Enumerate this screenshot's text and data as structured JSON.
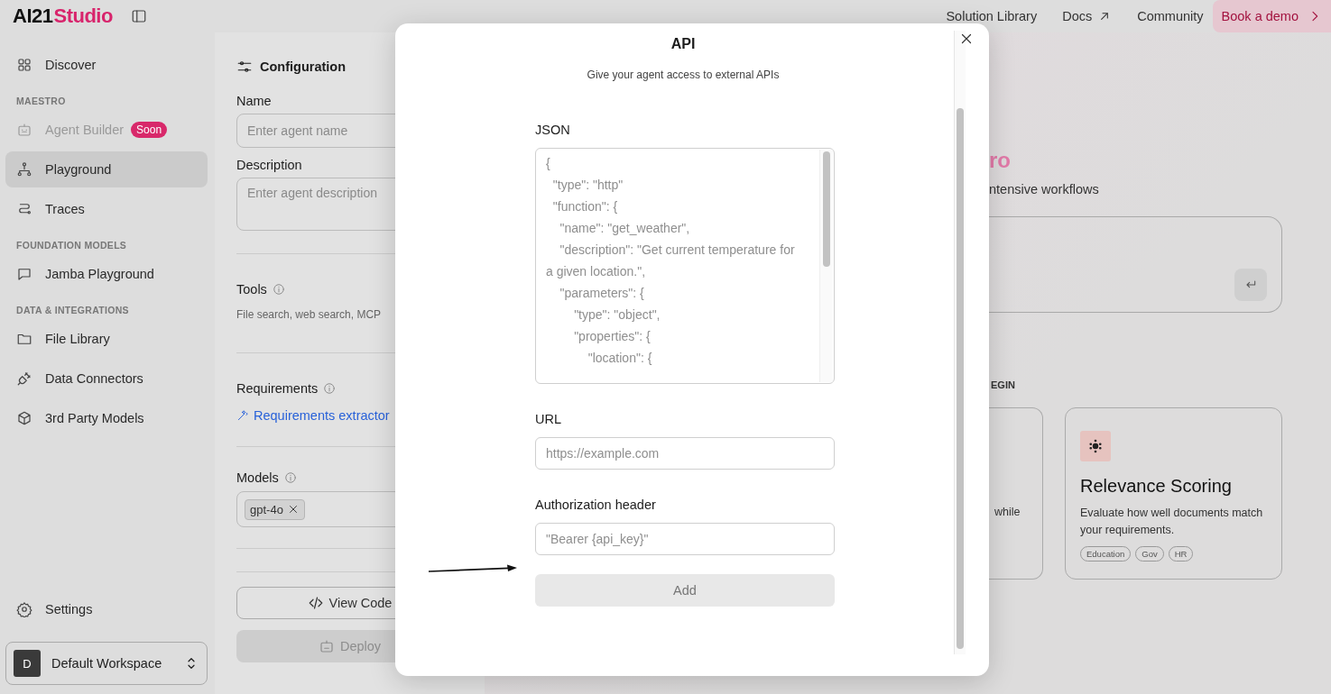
{
  "logo": {
    "part_1": "AI21",
    "part_2": "Studio"
  },
  "top_nav": {
    "links": [
      {
        "label": "Solution Library",
        "external": false
      },
      {
        "label": "Docs",
        "external": true
      },
      {
        "label": "Community",
        "external": false
      }
    ],
    "cta": "Book a demo"
  },
  "sidebar": {
    "sections": [
      {
        "items": [
          {
            "label": "Discover",
            "selected": false,
            "disabled": false
          }
        ]
      },
      {
        "heading": "MAESTRO",
        "items": [
          {
            "label": "Agent Builder",
            "selected": false,
            "disabled": true,
            "badge": "Soon"
          },
          {
            "label": "Playground",
            "selected": true,
            "disabled": false
          },
          {
            "label": "Traces",
            "selected": false,
            "disabled": false
          }
        ]
      },
      {
        "heading": "FOUNDATION MODELS",
        "items": [
          {
            "label": "Jamba Playground",
            "selected": false,
            "disabled": false
          }
        ]
      },
      {
        "heading": "DATA & INTEGRATIONS",
        "items": [
          {
            "label": "File Library",
            "selected": false,
            "disabled": false
          },
          {
            "label": "Data Connectors",
            "selected": false,
            "disabled": false
          },
          {
            "label": "3rd Party Models",
            "selected": false,
            "disabled": false
          }
        ]
      }
    ],
    "settings": "Settings",
    "workspace": {
      "initial": "D",
      "name": "Default Workspace"
    }
  },
  "config": {
    "title": "Configuration",
    "name": {
      "label": "Name",
      "placeholder": "Enter agent name"
    },
    "description": {
      "label": "Description",
      "placeholder": "Enter agent description"
    },
    "tools": {
      "label": "Tools",
      "hint": "File search, web search, MCP"
    },
    "requirements": {
      "label": "Requirements",
      "link": "Requirements extractor"
    },
    "models": {
      "label": "Models",
      "tags": [
        "gpt-4o"
      ]
    },
    "view_code": "View Code",
    "deploy": {
      "label": "Deploy",
      "disabled": true
    }
  },
  "main": {
    "heading_fragment": "ro",
    "subtitle_fragment": "ntensive workflows",
    "section_label_fragment": "EGIN",
    "cards": [
      {
        "description_fragment": "while"
      },
      {
        "title": "Relevance Scoring",
        "description": "Evaluate how well documents match your requirements.",
        "tags": [
          "Education",
          "Gov",
          "HR"
        ]
      }
    ]
  },
  "modal": {
    "title": "API",
    "subtitle": "Give your agent access to external APIs",
    "fields": [
      {
        "label": "JSON",
        "kind": "code",
        "placeholder": "{\n  \"type\": \"http\"\n  \"function\": {\n    \"name\": \"get_weather\",\n    \"description\": \"Get current temperature for a given location.\",\n    \"parameters\": {\n        \"type\": \"object\",\n        \"properties\": {\n            \"location\": {"
      },
      {
        "label": "URL",
        "kind": "text",
        "placeholder": "https://example.com"
      },
      {
        "label": "Authorization header",
        "kind": "text",
        "placeholder": "\"Bearer {api_key}\""
      }
    ],
    "submit": {
      "label": "Add",
      "disabled": true
    }
  }
}
